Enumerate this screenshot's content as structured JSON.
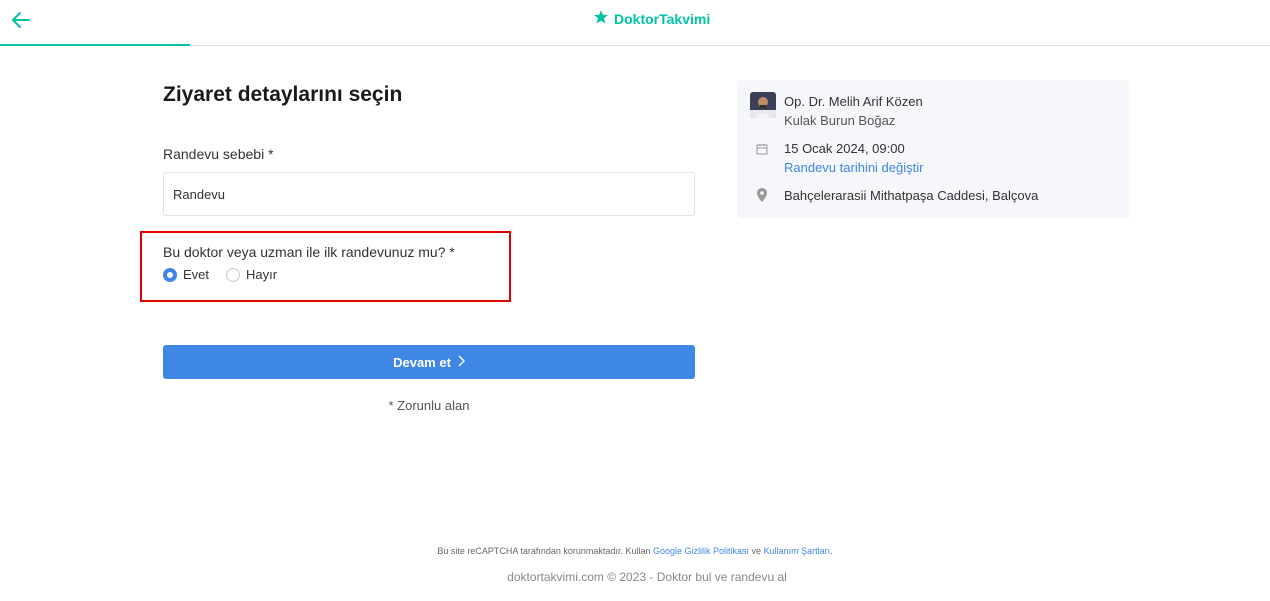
{
  "header": {
    "back_icon": "arrow-left-icon",
    "logo_icon": "star-pin-icon",
    "logo_text": "DoktorTakvimi",
    "brand_color": "#00c3a5",
    "progress": 0.15
  },
  "form": {
    "title": "Ziyaret detaylarını seçin",
    "reason_label": "Randevu sebebi *",
    "reason_value": "Randevu",
    "first_visit_question": "Bu doktor veya uzman ile ilk randevunuz mu? *",
    "options": [
      {
        "label": "Evet",
        "checked": true
      },
      {
        "label": "Hayır",
        "checked": false
      }
    ],
    "continue_label": "Devam et",
    "required_note": "* Zorunlu alan",
    "accent_color": "#3f87e5"
  },
  "summary": {
    "doctor_name": "Op. Dr. Melih Arif Közen",
    "specialty": "Kulak Burun Boğaz",
    "date_time": "15 Ocak 2024, 09:00",
    "change_date_link": "Randevu tarihini değiştir",
    "address": "Bahçelerarasii Mithatpaşa Caddesi, Balçova"
  },
  "footer": {
    "recaptcha_prefix": "Bu site reCAPTCHA tarafından korunmaktadır. Kullan",
    "privacy_link": "Google Gizlilik Politikası",
    "recaptcha_and": "ve",
    "terms_link": "Kullanım Şartları",
    "recaptcha_suffix": ".",
    "copyright": "doktortakvimi.com © 2023 - Doktor bul ve randevu al"
  }
}
